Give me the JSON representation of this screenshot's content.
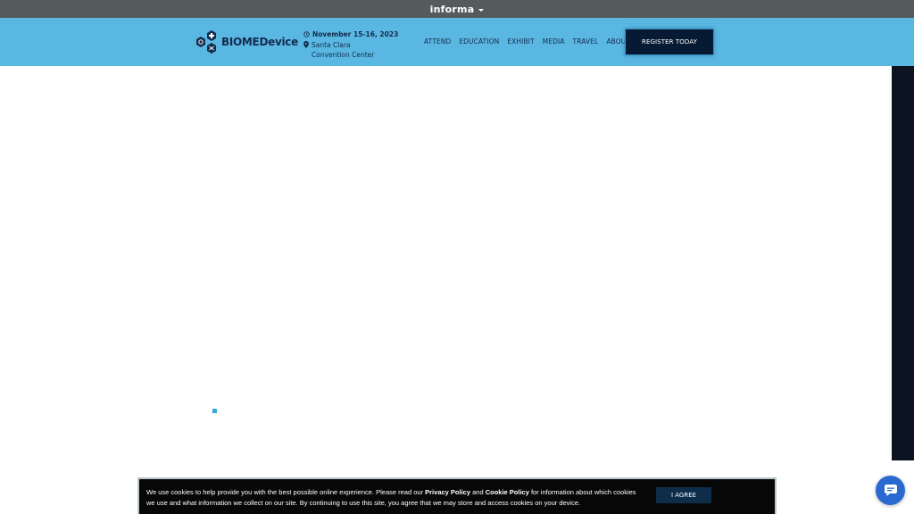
{
  "topbar": {
    "brand": "informa"
  },
  "header": {
    "logo_text": "BIOMEDevice",
    "date": "November 15-16, 2023",
    "venue_line1": "Santa Clara",
    "venue_line2": "Convention Center",
    "nav": [
      "ATTEND",
      "EDUCATION",
      "EXHIBIT",
      "MEDIA",
      "TRAVEL",
      "ABOUT"
    ],
    "register_label": "REGISTER TODAY"
  },
  "cookie": {
    "text_1": "We use cookies to help provide you with the best possible online experience. Please read our ",
    "privacy_link": "Privacy Policy",
    "text_2": " and ",
    "cookie_link": "Cookie Policy",
    "text_3": " for information about which cookies we use and what information we collect on our site. By continuing to use this site, you agree that we may store and access cookies on your device.",
    "agree_label": "I AGREE"
  },
  "colors": {
    "header_bg": "#5ab7e1",
    "topbar_bg": "#555a5c",
    "navy": "#132c4e",
    "chat_button": "#2a6ad0"
  },
  "icons": {
    "logo": "hexagon-plus-logo-icon",
    "date": "clock-icon",
    "venue": "map-pin-icon",
    "chat": "chat-bubble-icon"
  }
}
